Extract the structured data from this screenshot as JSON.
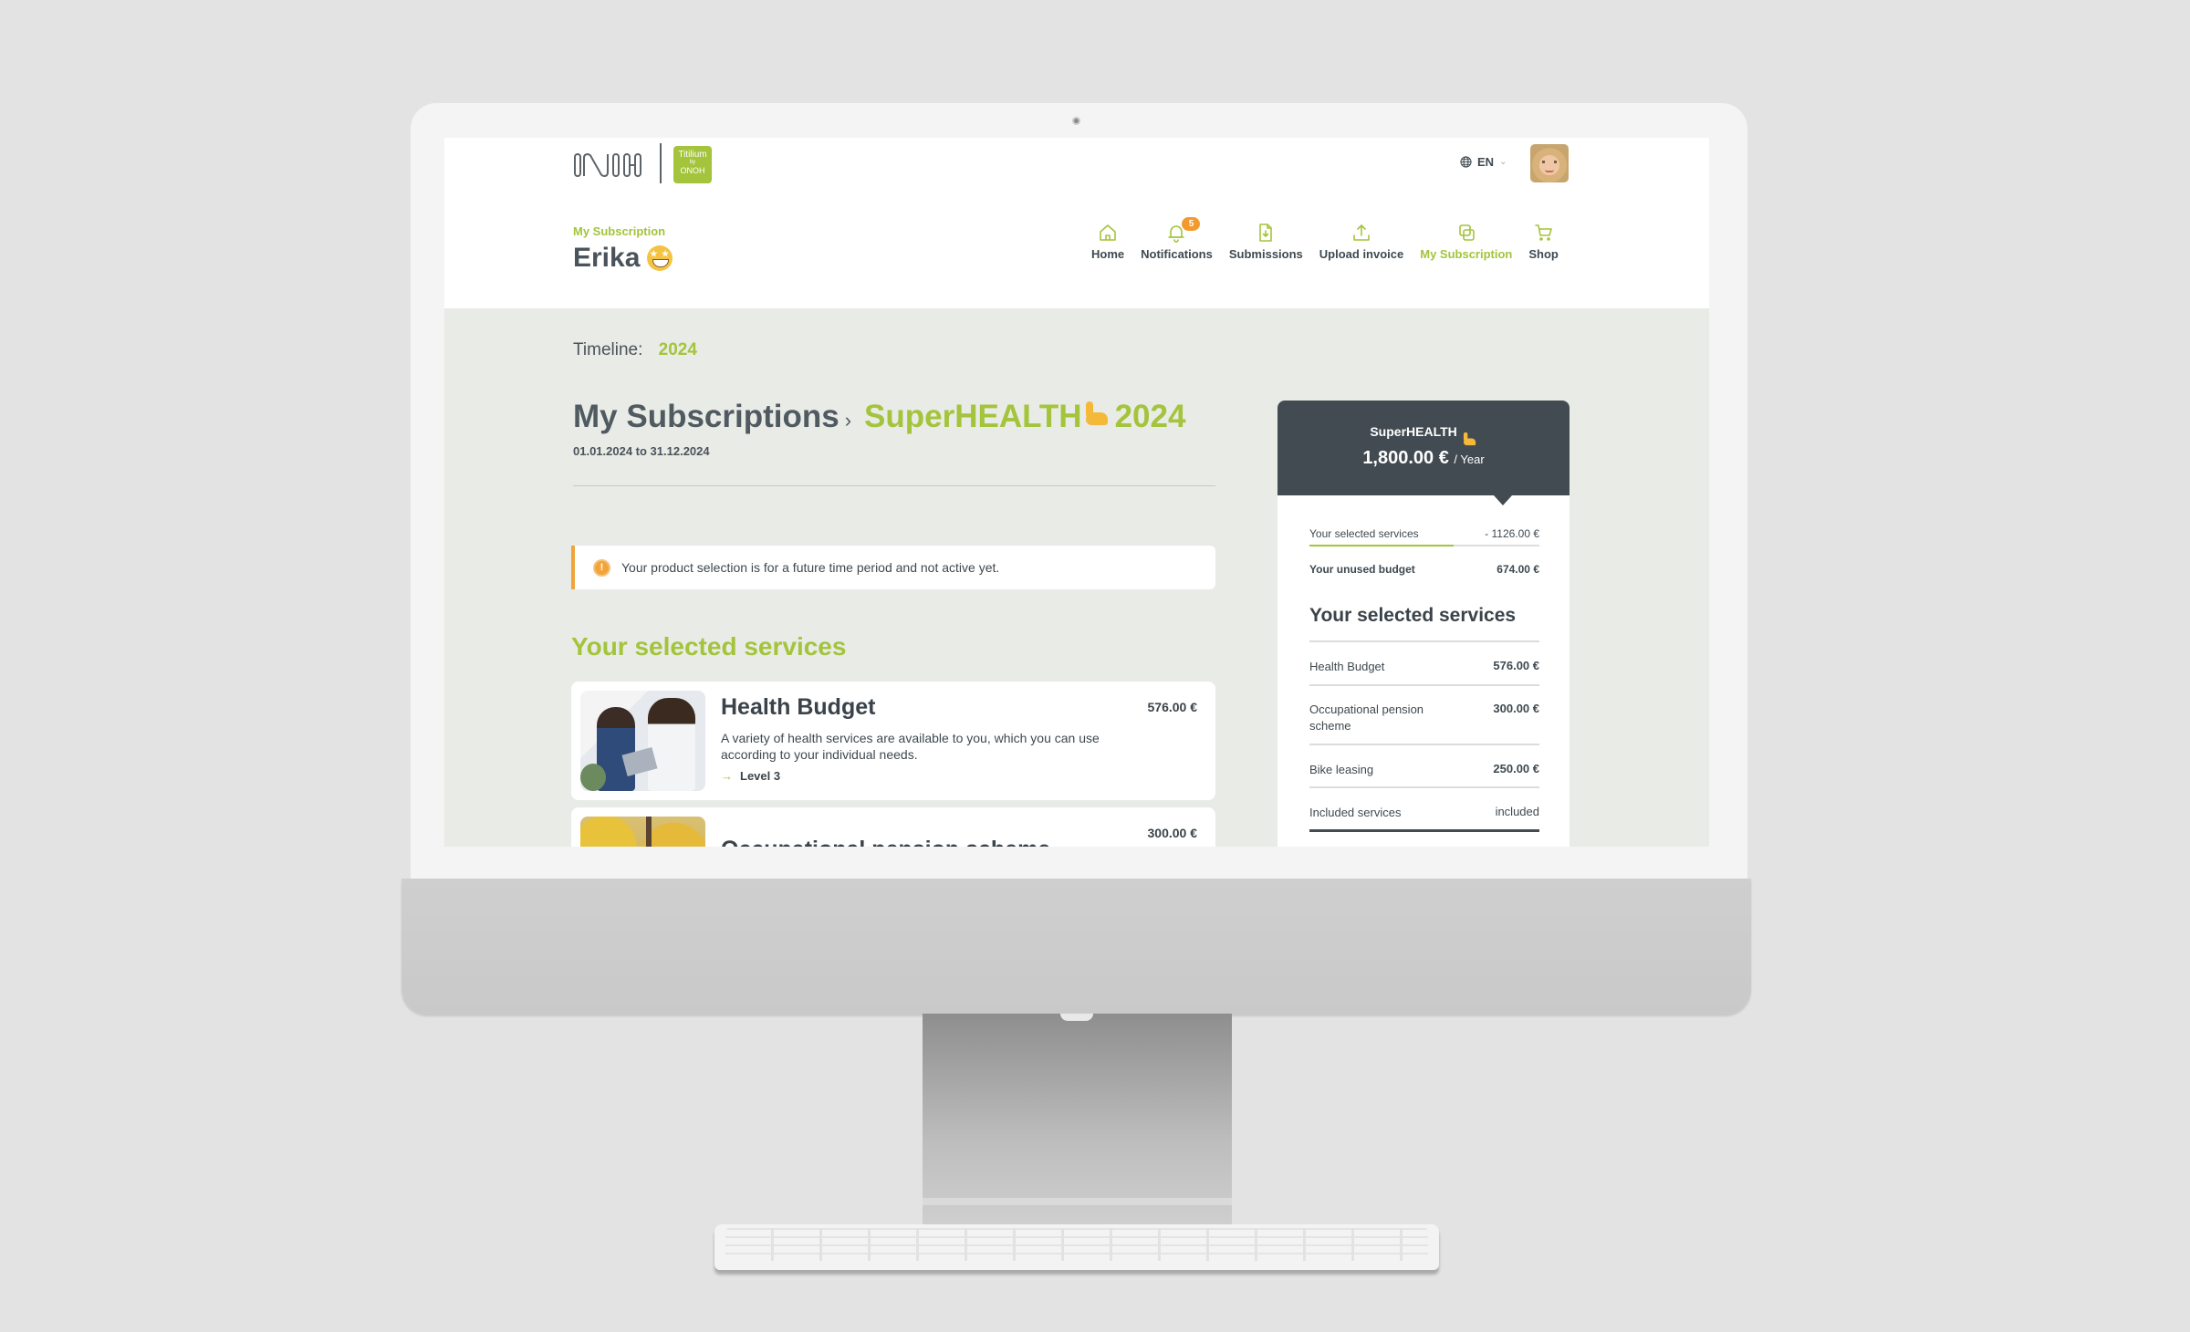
{
  "header": {
    "logo_text": "ONOH",
    "partner_logo": {
      "name": "Titilium",
      "by": "by",
      "brand": "ONOH"
    },
    "language": "EN",
    "page_label": "My Subscription",
    "user_name": "Erika",
    "nav": [
      {
        "label": "Home",
        "icon": "home-icon",
        "active": false
      },
      {
        "label": "Notifications",
        "icon": "bell-icon",
        "badge": "5",
        "active": false
      },
      {
        "label": "Submissions",
        "icon": "document-download-icon",
        "active": false
      },
      {
        "label": "Upload invoice",
        "icon": "upload-icon",
        "active": false
      },
      {
        "label": "My Subscription",
        "icon": "copy-icon",
        "active": true
      },
      {
        "label": "Shop",
        "icon": "cart-icon",
        "active": false
      }
    ]
  },
  "timeline": {
    "label": "Timeline:",
    "year": "2024"
  },
  "title": {
    "parent": "My Subscriptions",
    "current": "SuperHEALTH",
    "year": "2024",
    "dates": "01.01.2024 to 31.12.2024"
  },
  "alert": {
    "text": "Your product selection is for a future time period and not active yet."
  },
  "services": {
    "heading": "Your selected services",
    "cards": [
      {
        "title": "Health Budget",
        "description": "A variety of health services are available to you, which you can use according to your individual needs.",
        "level": "Level 3",
        "price": "576.00 €"
      },
      {
        "title": "Occupational pension scheme",
        "price": "300.00 €"
      }
    ]
  },
  "summary": {
    "plan_name": "SuperHEALTH",
    "plan_price": "1,800.00 €",
    "plan_period": "/ Year",
    "selected_label": "Your selected services",
    "selected_value": "- 1126.00 €",
    "used_fraction": 0.6256,
    "unused_label": "Your unused budget",
    "unused_value": "674.00 €",
    "list_heading": "Your selected services",
    "items": [
      {
        "name": "Health Budget",
        "value": "576.00 €"
      },
      {
        "name": "Occupational pension scheme",
        "value": "300.00 €"
      },
      {
        "name": "Bike leasing",
        "value": "250.00 €"
      },
      {
        "name": "Included services",
        "value": "included"
      }
    ]
  },
  "colors": {
    "accent": "#a3c43b",
    "dark": "#424b51",
    "warning": "#f0a43a",
    "badge": "#f29a2e"
  }
}
